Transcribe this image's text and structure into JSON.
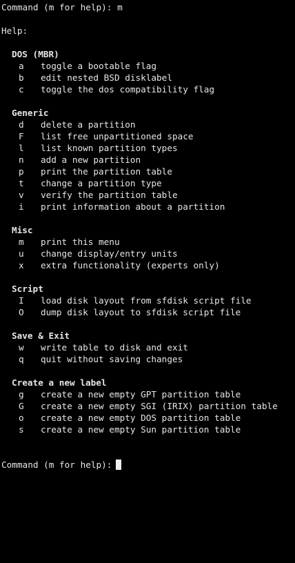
{
  "prompt_first": {
    "text": "Command (m for help):",
    "input": "m"
  },
  "help_heading": "Help:",
  "sections": [
    {
      "title": "DOS (MBR)",
      "items": [
        {
          "key": "a",
          "desc": "toggle a bootable flag"
        },
        {
          "key": "b",
          "desc": "edit nested BSD disklabel"
        },
        {
          "key": "c",
          "desc": "toggle the dos compatibility flag"
        }
      ]
    },
    {
      "title": "Generic",
      "items": [
        {
          "key": "d",
          "desc": "delete a partition"
        },
        {
          "key": "F",
          "desc": "list free unpartitioned space"
        },
        {
          "key": "l",
          "desc": "list known partition types"
        },
        {
          "key": "n",
          "desc": "add a new partition"
        },
        {
          "key": "p",
          "desc": "print the partition table"
        },
        {
          "key": "t",
          "desc": "change a partition type"
        },
        {
          "key": "v",
          "desc": "verify the partition table"
        },
        {
          "key": "i",
          "desc": "print information about a partition"
        }
      ]
    },
    {
      "title": "Misc",
      "items": [
        {
          "key": "m",
          "desc": "print this menu"
        },
        {
          "key": "u",
          "desc": "change display/entry units"
        },
        {
          "key": "x",
          "desc": "extra functionality (experts only)"
        }
      ]
    },
    {
      "title": "Script",
      "items": [
        {
          "key": "I",
          "desc": "load disk layout from sfdisk script file"
        },
        {
          "key": "O",
          "desc": "dump disk layout to sfdisk script file"
        }
      ]
    },
    {
      "title": "Save & Exit",
      "items": [
        {
          "key": "w",
          "desc": "write table to disk and exit"
        },
        {
          "key": "q",
          "desc": "quit without saving changes"
        }
      ]
    },
    {
      "title": "Create a new label",
      "items": [
        {
          "key": "g",
          "desc": "create a new empty GPT partition table"
        },
        {
          "key": "G",
          "desc": "create a new empty SGI (IRIX) partition table"
        },
        {
          "key": "o",
          "desc": "create a new empty DOS partition table"
        },
        {
          "key": "s",
          "desc": "create a new empty Sun partition table"
        }
      ]
    }
  ],
  "prompt_last": {
    "text": "Command (m for help):",
    "input": ""
  },
  "colors": {
    "background": "#000000",
    "foreground": "#e6e6e6",
    "cursor": "#f0f0f0"
  }
}
